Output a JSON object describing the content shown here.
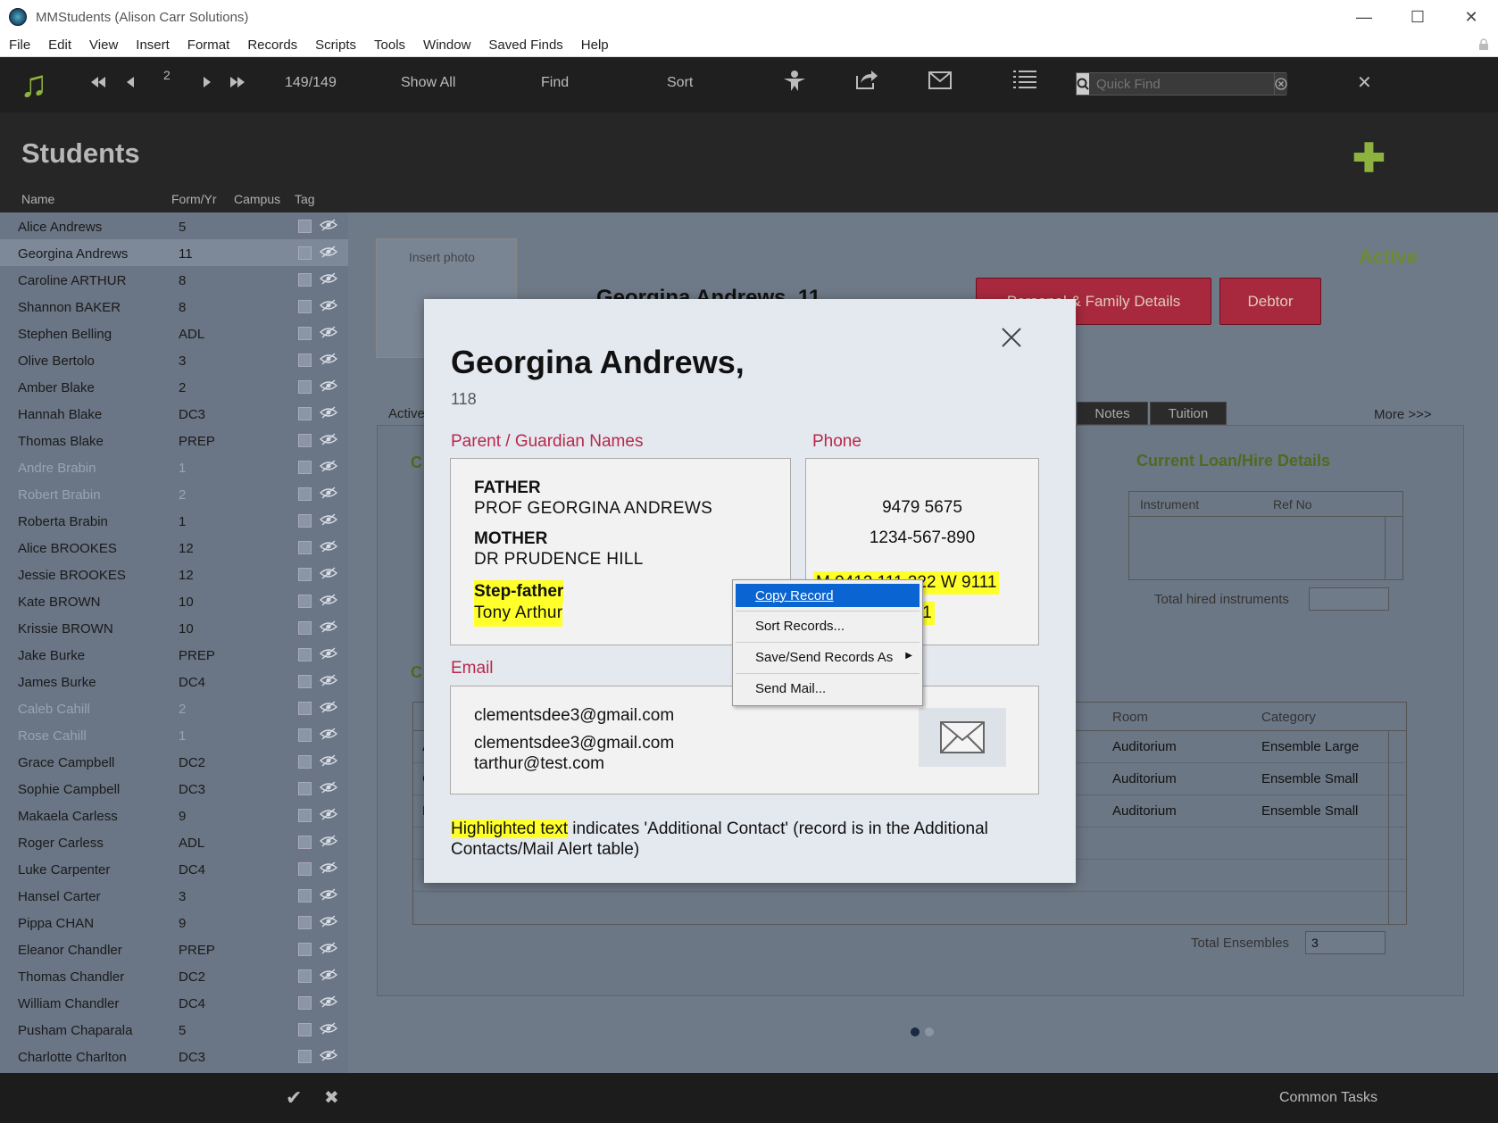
{
  "window": {
    "title": "MMStudents (Alison Carr Solutions)",
    "controls": [
      "—",
      "☐",
      "✕"
    ]
  },
  "menu": [
    "File",
    "Edit",
    "View",
    "Insert",
    "Format",
    "Records",
    "Scripts",
    "Tools",
    "Window",
    "Saved Finds",
    "Help"
  ],
  "toolbar": {
    "record_number": "2",
    "record_count": "149/149",
    "show_all": "Show All",
    "find": "Find",
    "sort": "Sort",
    "quick_find_placeholder": "Quick Find",
    "close": "✕"
  },
  "header": {
    "title": "Students",
    "columns": {
      "name": "Name",
      "form": "Form/Yr",
      "campus": "Campus",
      "tag": "Tag"
    }
  },
  "students": [
    {
      "name": "Alice Andrews",
      "form": "5",
      "dim": false,
      "selected": false
    },
    {
      "name": "Georgina Andrews",
      "form": "11",
      "dim": false,
      "selected": true
    },
    {
      "name": "Caroline ARTHUR",
      "form": "8",
      "dim": false,
      "selected": false
    },
    {
      "name": "Shannon BAKER",
      "form": "8",
      "dim": false,
      "selected": false
    },
    {
      "name": "Stephen Belling",
      "form": "ADL",
      "dim": false,
      "selected": false
    },
    {
      "name": "Olive Bertolo",
      "form": "3",
      "dim": false,
      "selected": false
    },
    {
      "name": "Amber Blake",
      "form": "2",
      "dim": false,
      "selected": false
    },
    {
      "name": "Hannah Blake",
      "form": "DC3",
      "dim": false,
      "selected": false
    },
    {
      "name": "Thomas Blake",
      "form": "PREP",
      "dim": false,
      "selected": false
    },
    {
      "name": "Andre Brabin",
      "form": "1",
      "dim": true,
      "selected": false
    },
    {
      "name": "Robert Brabin",
      "form": "2",
      "dim": true,
      "selected": false
    },
    {
      "name": "Roberta Brabin",
      "form": "1",
      "dim": false,
      "selected": false
    },
    {
      "name": "Alice BROOKES",
      "form": "12",
      "dim": false,
      "selected": false
    },
    {
      "name": "Jessie BROOKES",
      "form": "12",
      "dim": false,
      "selected": false
    },
    {
      "name": "Kate BROWN",
      "form": "10",
      "dim": false,
      "selected": false
    },
    {
      "name": "Krissie BROWN",
      "form": "10",
      "dim": false,
      "selected": false
    },
    {
      "name": "Jake Burke",
      "form": "PREP",
      "dim": false,
      "selected": false
    },
    {
      "name": "James Burke",
      "form": "DC4",
      "dim": false,
      "selected": false
    },
    {
      "name": "Caleb Cahill",
      "form": "2",
      "dim": true,
      "selected": false
    },
    {
      "name": "Rose Cahill",
      "form": "1",
      "dim": true,
      "selected": false
    },
    {
      "name": "Grace Campbell",
      "form": "DC2",
      "dim": false,
      "selected": false
    },
    {
      "name": "Sophie Campbell",
      "form": "DC3",
      "dim": false,
      "selected": false
    },
    {
      "name": "Makaela Carless",
      "form": "9",
      "dim": false,
      "selected": false
    },
    {
      "name": "Roger Carless",
      "form": "ADL",
      "dim": false,
      "selected": false
    },
    {
      "name": "Luke Carpenter",
      "form": "DC4",
      "dim": false,
      "selected": false
    },
    {
      "name": "Hansel Carter",
      "form": "3",
      "dim": false,
      "selected": false
    },
    {
      "name": "Pippa CHAN",
      "form": "9",
      "dim": false,
      "selected": false
    },
    {
      "name": "Eleanor Chandler",
      "form": "PREP",
      "dim": false,
      "selected": false
    },
    {
      "name": "Thomas Chandler",
      "form": "DC2",
      "dim": false,
      "selected": false
    },
    {
      "name": "William Chandler",
      "form": "DC4",
      "dim": false,
      "selected": false
    },
    {
      "name": "Pusham Chaparala",
      "form": "5",
      "dim": false,
      "selected": false
    },
    {
      "name": "Charlotte Charlton",
      "form": "DC3",
      "dim": false,
      "selected": false
    }
  ],
  "record": {
    "insert_photo": "Insert photo",
    "name_partial": "Georgina Andrews, 11",
    "family_button": "Personal & Family Details",
    "debtor_button": "Debtor",
    "status": "Active",
    "tabs": [
      {
        "label": "Active"
      },
      {
        "label": "e"
      },
      {
        "label": "Notes"
      },
      {
        "label": "Tuition"
      }
    ],
    "more": "More >>>",
    "section_c1": "C",
    "section_c2": "C",
    "loan_title": "Current Loan/Hire Details",
    "loan_cols": {
      "instrument": "Instrument",
      "ref": "Ref No"
    },
    "total_hired_label": "Total hired instruments",
    "total_hired_value": "",
    "ensemble_cols": {
      "room": "Room",
      "category": "Category"
    },
    "ensembles": [
      {
        "first": "A",
        "room": "Auditorium",
        "category": "Ensemble Large"
      },
      {
        "first": "C",
        "room": "Auditorium",
        "category": "Ensemble Small"
      },
      {
        "first": "F",
        "room": "Auditorium",
        "category": "Ensemble Small"
      }
    ],
    "total_ensembles_label": "Total Ensembles",
    "total_ensembles_value": "3"
  },
  "modal": {
    "name": "Georgina Andrews,",
    "id": "118",
    "guardian_label": "Parent / Guardian Names",
    "phone_label": "Phone",
    "email_label": "Email",
    "guardians": [
      {
        "role": "FATHER",
        "name": "PROF GEORGINA ANDREWS",
        "highlighted": false
      },
      {
        "role": "MOTHER",
        "name": "DR PRUDENCE HILL",
        "highlighted": false
      },
      {
        "role": "Step-father",
        "name": "Tony Arthur",
        "highlighted": true
      }
    ],
    "phones": [
      "9479 5675",
      "1234-567-890"
    ],
    "phone_highlighted_1": "M 0412 111 222  W 9111",
    "phone_highlighted_2": "11",
    "emails": [
      "clementsdee3@gmail.com",
      "clementsdee3@gmail.com",
      "tarthur@test.com"
    ],
    "footnote_highlight": "Highlighted text",
    "footnote_rest": " indicates 'Additional Contact' (record is in the Additional Contacts/Mail Alert table)"
  },
  "context_menu": [
    {
      "label": "Copy Record",
      "active": true
    },
    {
      "label": "Sort Records...",
      "active": false
    },
    {
      "label": "Save/Send Records As",
      "active": false,
      "submenu": true
    },
    {
      "label": "Send Mail...",
      "active": false
    }
  ],
  "bottom": {
    "common_tasks": "Common Tasks"
  },
  "colors": {
    "accent_green": "#8db23d",
    "button_red": "#a8293e",
    "highlight_yellow": "#ffff2a",
    "section_red": "#b8284a",
    "menu_blue": "#0a64d2"
  }
}
